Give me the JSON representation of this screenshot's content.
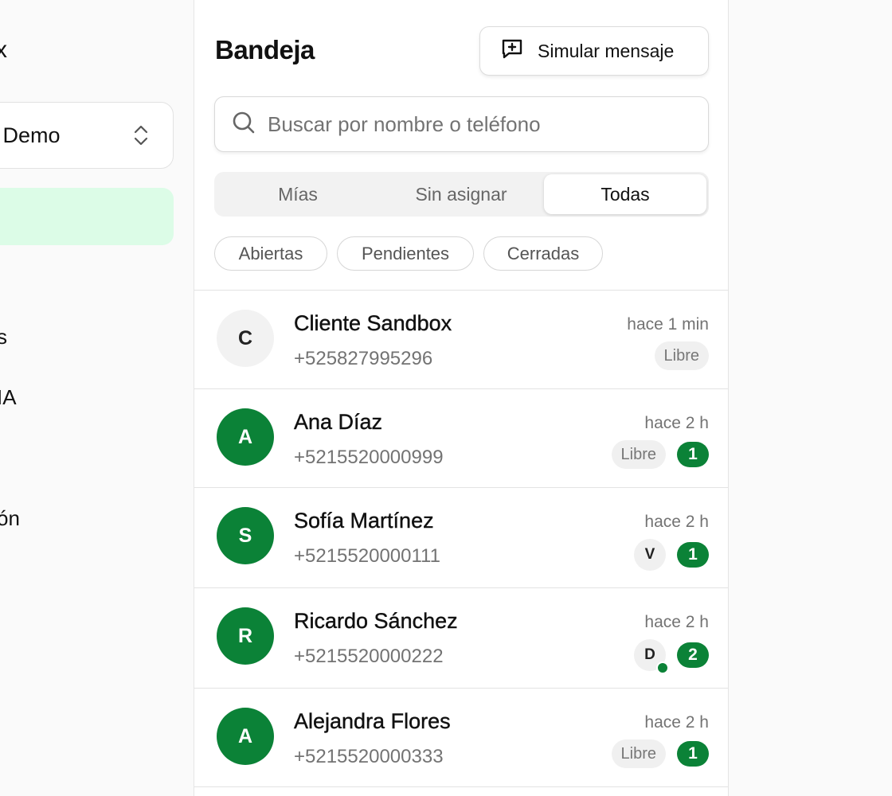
{
  "sidebar": {
    "brand_fragment": "x",
    "workspace": {
      "label": "a Demo"
    },
    "nav_fragments": [
      "s",
      "IA",
      "ón"
    ]
  },
  "inbox": {
    "title": "Bandeja",
    "simulate_button": {
      "label": "Simular mensaje",
      "icon": "message-plus-icon"
    },
    "search": {
      "placeholder": "Buscar por nombre o teléfono",
      "value": ""
    },
    "scope_tabs": [
      {
        "label": "Mías",
        "active": false
      },
      {
        "label": "Sin asignar",
        "active": false
      },
      {
        "label": "Todas",
        "active": true
      }
    ],
    "status_filters": [
      "Abiertas",
      "Pendientes",
      "Cerradas"
    ],
    "colors": {
      "accent": "#0b8237",
      "active_nav": "#dcfce7"
    },
    "conversations": [
      {
        "initial": "C",
        "name": "Cliente Sandbox",
        "phone": "+525827995296",
        "time": "hace 1 min",
        "assignee": "Libre",
        "unread": null,
        "avatar_style": "grey"
      },
      {
        "initial": "A",
        "name": "Ana Díaz",
        "phone": "+5215520000999",
        "time": "hace 2 h",
        "assignee": "Libre",
        "unread": "1",
        "avatar_style": "green"
      },
      {
        "initial": "S",
        "name": "Sofía Martínez",
        "phone": "+5215520000111",
        "time": "hace 2 h",
        "assignee": "V",
        "unread": "1",
        "avatar_style": "green"
      },
      {
        "initial": "R",
        "name": "Ricardo Sánchez",
        "phone": "+5215520000222",
        "time": "hace 2 h",
        "assignee": "D",
        "assignee_online": true,
        "unread": "2",
        "avatar_style": "green"
      },
      {
        "initial": "A",
        "name": "Alejandra Flores",
        "phone": "+5215520000333",
        "time": "hace 2 h",
        "assignee": "Libre",
        "unread": "1",
        "avatar_style": "green"
      }
    ]
  }
}
